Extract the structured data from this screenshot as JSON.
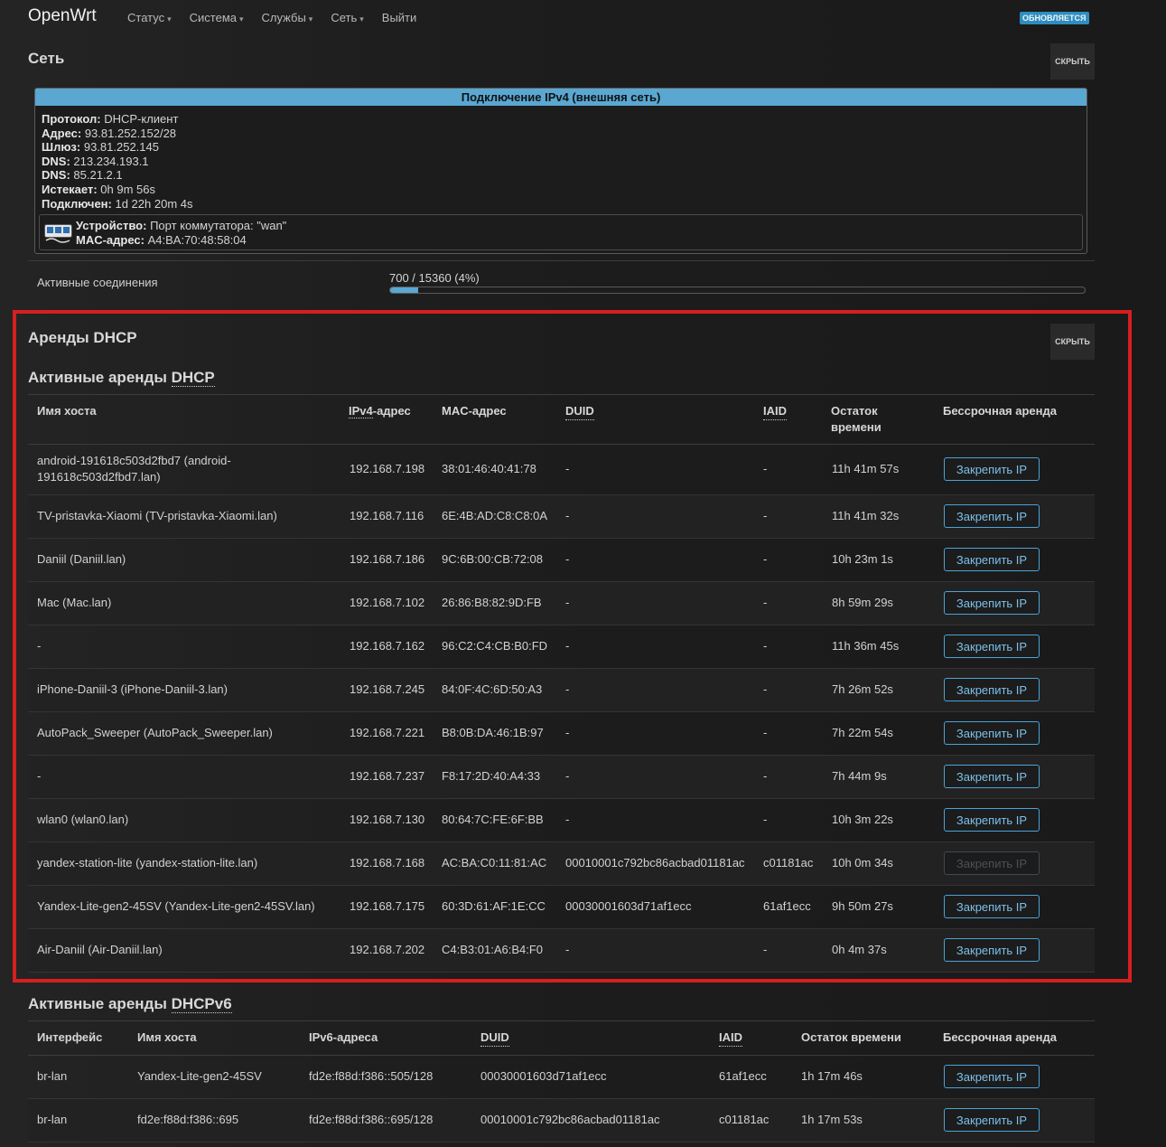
{
  "nav": {
    "brand": "OpenWrt",
    "menu": [
      {
        "label": "Статус",
        "dropdown": true
      },
      {
        "label": "Система",
        "dropdown": true
      },
      {
        "label": "Службы",
        "dropdown": true
      },
      {
        "label": "Сеть",
        "dropdown": true
      },
      {
        "label": "Выйти",
        "dropdown": false
      }
    ],
    "badge": "ОБНОВЛЯЕТСЯ"
  },
  "network": {
    "title": "Сеть",
    "hide_label": "СКРЫТЬ",
    "iface_header": "Подключение IPv4 (внешняя сеть)",
    "fields": [
      {
        "label": "Протокол:",
        "value": "DHCP-клиент"
      },
      {
        "label": "Адрес:",
        "value": "93.81.252.152/28"
      },
      {
        "label": "Шлюз:",
        "value": "93.81.252.145"
      },
      {
        "label": "DNS:",
        "value": "213.234.193.1"
      },
      {
        "label": "DNS:",
        "value": "85.21.2.1"
      },
      {
        "label": "Истекает:",
        "value": "0h 9m 56s"
      },
      {
        "label": "Подключен:",
        "value": "1d 22h 20m 4s"
      }
    ],
    "device": {
      "device_label": "Устройство:",
      "device_value": "Порт коммутатора: \"wan\"",
      "mac_label": "MAC-адрес:",
      "mac_value": "A4:BA:70:48:58:04"
    },
    "connections_label": "Активные соединения",
    "connections_text": "700 / 15360 (4%)",
    "connections_fraction": 0.04
  },
  "dhcp": {
    "title": "Аренды DHCP",
    "hide_label": "СКРЫТЬ",
    "active_prefix": "Активные аренды ",
    "active_abbr": "DHCP",
    "columns": [
      "Имя хоста",
      "IPv4-адрес",
      "MAC-адрес",
      "DUID",
      "IAID",
      "Остаток времени",
      "Бессрочная аренда"
    ],
    "col_ipv4_abbr": "IPv4",
    "col_ipv4_rest": "-адрес",
    "col_remaining_1": "Остаток",
    "col_remaining_2": "времени",
    "rows": [
      {
        "host": "android-191618c503d2fbd7 (android-191618c503d2fbd7.lan)",
        "ip": "192.168.7.198",
        "mac": "38:01:46:40:41:78",
        "duid": "-",
        "iaid": "-",
        "remaining": "11h 41m 57s",
        "button": "Закрепить IP",
        "disabled": false
      },
      {
        "host": "TV-pristavka-Xiaomi (TV-pristavka-Xiaomi.lan)",
        "ip": "192.168.7.116",
        "mac": "6E:4B:AD:C8:C8:0A",
        "duid": "-",
        "iaid": "-",
        "remaining": "11h 41m 32s",
        "button": "Закрепить IP",
        "disabled": false
      },
      {
        "host": "Daniil (Daniil.lan)",
        "ip": "192.168.7.186",
        "mac": "9C:6B:00:CB:72:08",
        "duid": "-",
        "iaid": "-",
        "remaining": "10h 23m 1s",
        "button": "Закрепить IP",
        "disabled": false
      },
      {
        "host": "Mac (Mac.lan)",
        "ip": "192.168.7.102",
        "mac": "26:86:B8:82:9D:FB",
        "duid": "-",
        "iaid": "-",
        "remaining": "8h 59m 29s",
        "button": "Закрепить IP",
        "disabled": false
      },
      {
        "host": "-",
        "ip": "192.168.7.162",
        "mac": "96:C2:C4:CB:B0:FD",
        "duid": "-",
        "iaid": "-",
        "remaining": "11h 36m 45s",
        "button": "Закрепить IP",
        "disabled": false
      },
      {
        "host": "iPhone-Daniil-3 (iPhone-Daniil-3.lan)",
        "ip": "192.168.7.245",
        "mac": "84:0F:4C:6D:50:A3",
        "duid": "-",
        "iaid": "-",
        "remaining": "7h 26m 52s",
        "button": "Закрепить IP",
        "disabled": false
      },
      {
        "host": "AutoPack_Sweeper (AutoPack_Sweeper.lan)",
        "ip": "192.168.7.221",
        "mac": "B8:0B:DA:46:1B:97",
        "duid": "-",
        "iaid": "-",
        "remaining": "7h 22m 54s",
        "button": "Закрепить IP",
        "disabled": false
      },
      {
        "host": "-",
        "ip": "192.168.7.237",
        "mac": "F8:17:2D:40:A4:33",
        "duid": "-",
        "iaid": "-",
        "remaining": "7h 44m 9s",
        "button": "Закрепить IP",
        "disabled": false
      },
      {
        "host": "wlan0 (wlan0.lan)",
        "ip": "192.168.7.130",
        "mac": "80:64:7C:FE:6F:BB",
        "duid": "-",
        "iaid": "-",
        "remaining": "10h 3m 22s",
        "button": "Закрепить IP",
        "disabled": false
      },
      {
        "host": "yandex-station-lite (yandex-station-lite.lan)",
        "ip": "192.168.7.168",
        "mac": "AC:BA:C0:11:81:AC",
        "duid": "00010001c792bc86acbad01181ac",
        "iaid": "c01181ac",
        "remaining": "10h 0m 34s",
        "button": "Закрепить IP",
        "disabled": true
      },
      {
        "host": "Yandex-Lite-gen2-45SV (Yandex-Lite-gen2-45SV.lan)",
        "ip": "192.168.7.175",
        "mac": "60:3D:61:AF:1E:CC",
        "duid": "00030001603d71af1ecc",
        "iaid": "61af1ecc",
        "remaining": "9h 50m 27s",
        "button": "Закрепить IP",
        "disabled": false
      },
      {
        "host": "Air-Daniil (Air-Daniil.lan)",
        "ip": "192.168.7.202",
        "mac": "C4:B3:01:A6:B4:F0",
        "duid": "-",
        "iaid": "-",
        "remaining": "0h 4m 37s",
        "button": "Закрепить IP",
        "disabled": false
      }
    ]
  },
  "dhcpv6": {
    "active_prefix": "Активные аренды ",
    "active_abbr": "DHCPv6",
    "columns": [
      "Интерфейс",
      "Имя хоста",
      "IPv6-адреса",
      "DUID",
      "IAID",
      "Остаток времени",
      "Бессрочная аренда"
    ],
    "rows": [
      {
        "iface": "br-lan",
        "host": "Yandex-Lite-gen2-45SV",
        "ipv6": "fd2e:f88d:f386::505/128",
        "duid": "00030001603d71af1ecc",
        "iaid": "61af1ecc",
        "remaining": "1h 17m 46s",
        "button": "Закрепить IP"
      },
      {
        "iface": "br-lan",
        "host": "fd2e:f88d:f386::695",
        "ipv6": "fd2e:f88d:f386::695/128",
        "duid": "00010001c792bc86acbad01181ac",
        "iaid": "c01181ac",
        "remaining": "1h 17m 53s",
        "button": "Закрепить IP"
      }
    ]
  }
}
